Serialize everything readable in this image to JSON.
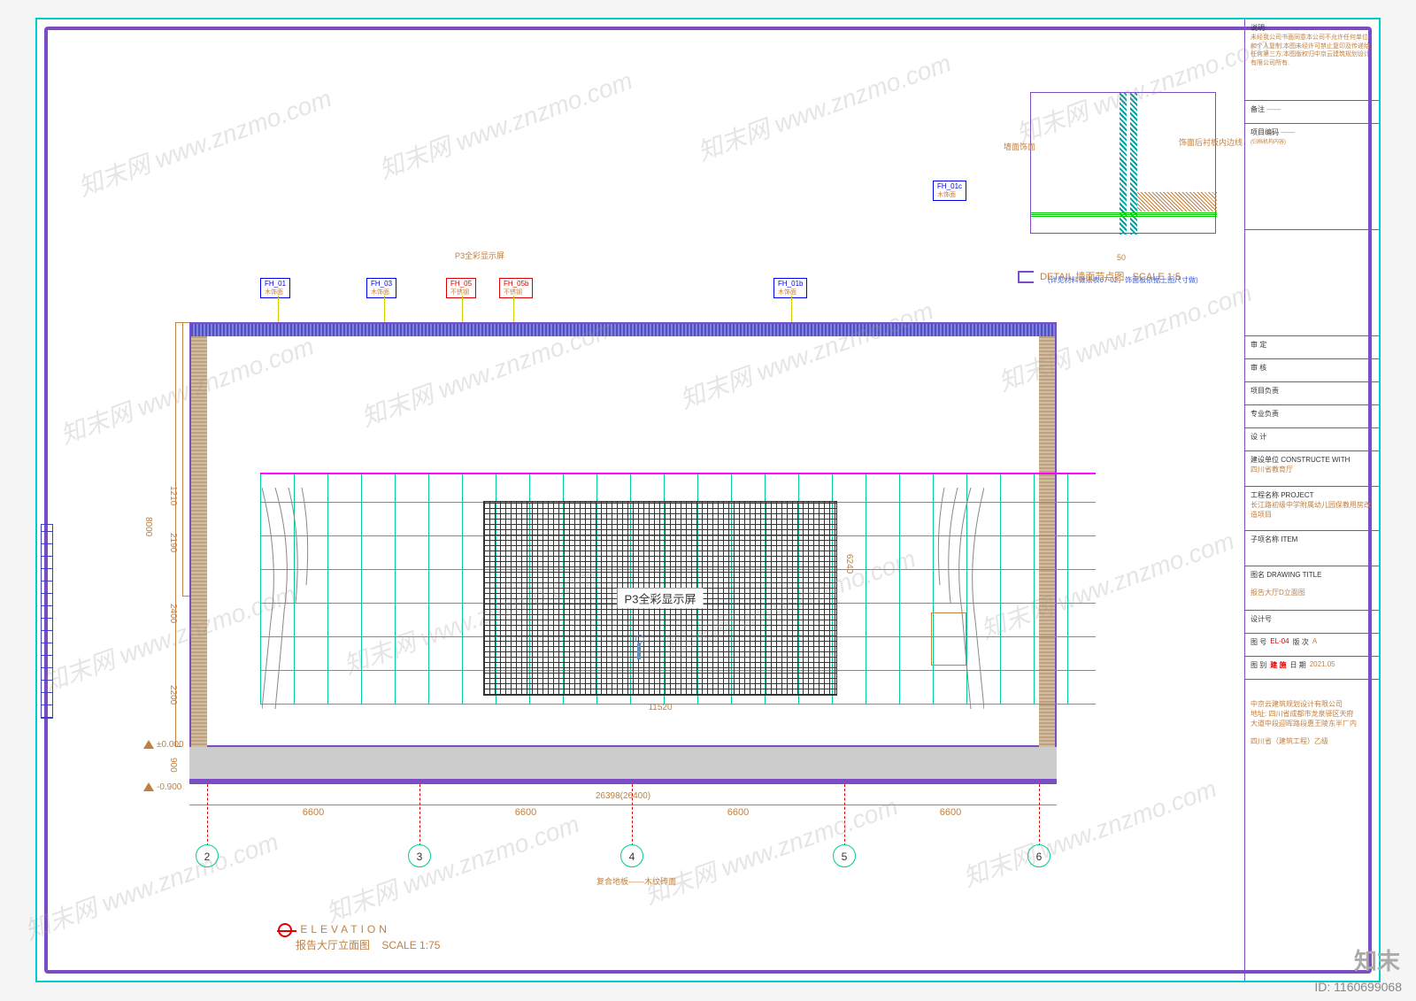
{
  "domain": "Diagram",
  "drawing": {
    "elevation_title": "ELEVATION",
    "elevation_subtitle": "报告大厅立面图",
    "elevation_scale": "SCALE 1:75",
    "detail_title": "DETAIL  墙面节点图",
    "detail_scale": "SCALE 1:5",
    "screen_label": "P3全彩显示屏",
    "screen_width": "11520",
    "screen_height": "6240",
    "datum_top": "±0.000",
    "datum_bottom": "-0.900",
    "total_height": "8000",
    "total_width": "26398(26400)",
    "floor_depth": "900",
    "dims_vertical": [
      "1210",
      "2190",
      "2400",
      "2200"
    ],
    "axis_numbers": [
      "2",
      "3",
      "4",
      "5",
      "6"
    ],
    "axis_spans": [
      "6600",
      "6600",
      "6600",
      "6600"
    ],
    "callouts": [
      {
        "id": "FH_01",
        "sub": "木饰面"
      },
      {
        "id": "FH_03",
        "sub": "木饰面"
      },
      {
        "id": "FH_05",
        "sub": "不锈钢"
      },
      {
        "id": "FH_05b",
        "sub": "不锈钢"
      },
      {
        "id": "FH_01b",
        "sub": "木饰面"
      },
      {
        "id": "FH_01c",
        "sub": "木饰面"
      }
    ],
    "detail_labels": {
      "wall": "墙面饰面",
      "panel": "饰面后衬板内边线",
      "base_note": "(详见材料做法表07-02，饰面板依据上图尺寸做)",
      "dim_50": "50"
    },
    "bottom_notes": {
      "composite": "复合地板——木纹砖面"
    }
  },
  "titleblock": {
    "notice_label": "说明:",
    "notice": "未经我公司书面同意本公司不允许任何单位和个人复制;本图未经许可禁止复印及传递给任何第三方;本图版权归中京云建筑规划设计有限公司所有.",
    "remark_label": "备注",
    "remark_value": "——",
    "project_code_label": "项目编码",
    "project_code_sub": "(归档机构内容)",
    "project_code_value": "——",
    "approve": "审  定",
    "review": "审  核",
    "pm": "项目负责",
    "discipline": "专业负责",
    "design": "设  计",
    "client_label": "建设单位  CONSTRUCTE WITH",
    "client_value": "四川省教育厅",
    "project_label": "工程名称  PROJECT",
    "project_value": "长江路初级中学附属幼儿园保教用房改造项目",
    "item_label": "子项名称  ITEM",
    "drawing_title_label": "图名    DRAWING TITLE",
    "drawing_title_value": "报告大厅D立面图",
    "design_no_label": "设计号",
    "sheet_no_label": "图 号",
    "sheet_no_value": "EL-04",
    "rev_label": "版 次",
    "rev_value": "A",
    "category_label": "图 别",
    "category_value": "建 施",
    "date_label": "日 期",
    "date_value": "2021.05",
    "company": "中京云建筑规划设计有限公司",
    "address": "地址: 四川省成都市龙泉驿区天府",
    "address2": "大道中段迎晖路段惠王陵东半厂内",
    "footer": "四川省（建筑工程）乙级"
  },
  "meta": {
    "watermark": "知末网 www.znzmo.com",
    "id": "ID: 1160699068",
    "logo": "知末"
  }
}
